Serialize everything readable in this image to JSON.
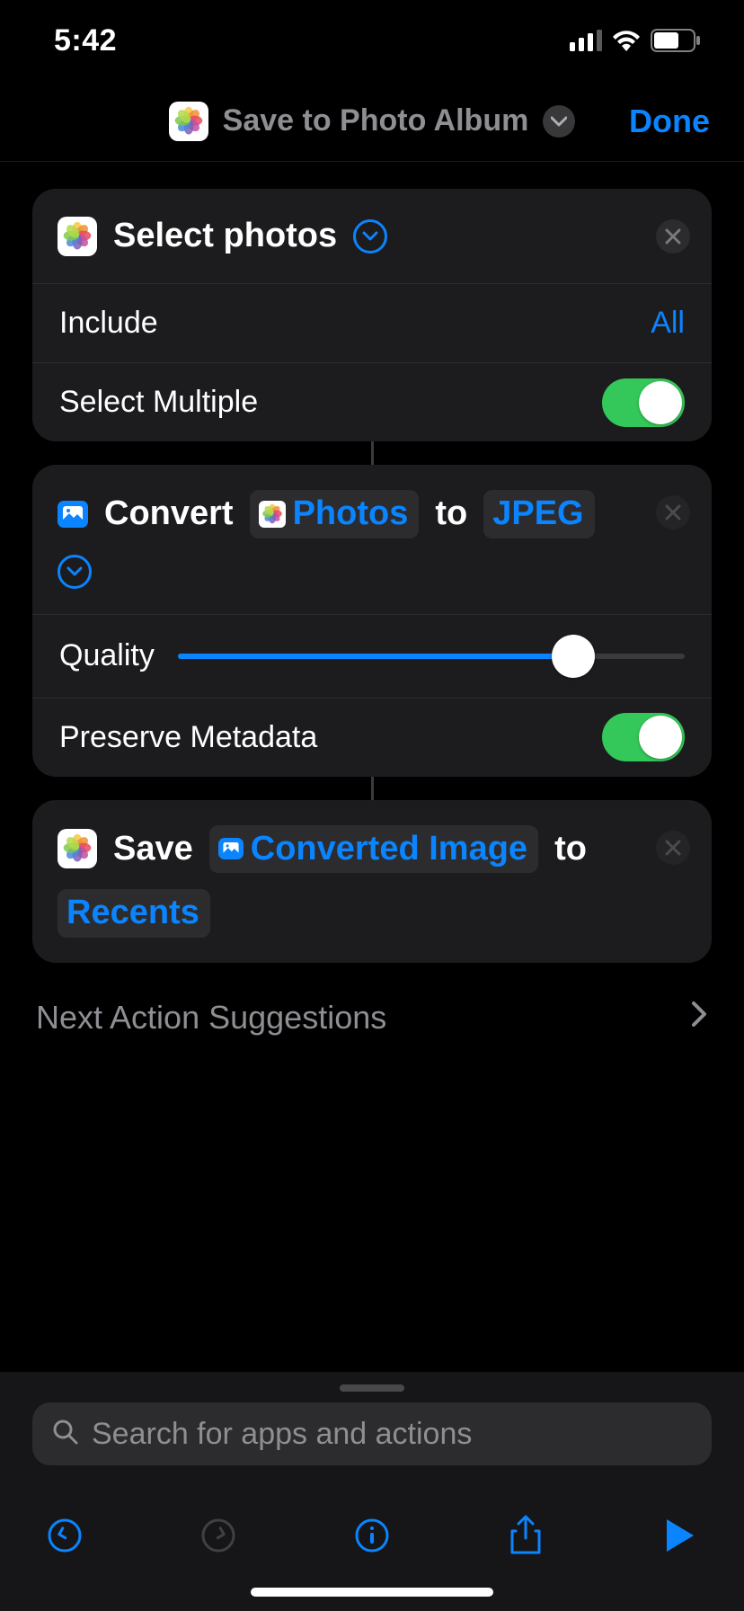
{
  "status": {
    "time": "5:42"
  },
  "nav": {
    "title": "Save to Photo Album",
    "done": "Done"
  },
  "action1": {
    "title": "Select photos",
    "include_label": "Include",
    "include_value": "All",
    "multiple_label": "Select Multiple",
    "multiple_on": true
  },
  "action2": {
    "prefix": "Convert",
    "input_token": "Photos",
    "mid": "to",
    "format": "JPEG",
    "quality_label": "Quality",
    "quality_percent": 78,
    "preserve_label": "Preserve Metadata",
    "preserve_on": true
  },
  "action3": {
    "prefix": "Save",
    "input_token": "Converted Image",
    "mid": "to",
    "album": "Recents"
  },
  "suggestions": {
    "label": "Next Action Suggestions"
  },
  "search": {
    "placeholder": "Search for apps and actions"
  }
}
